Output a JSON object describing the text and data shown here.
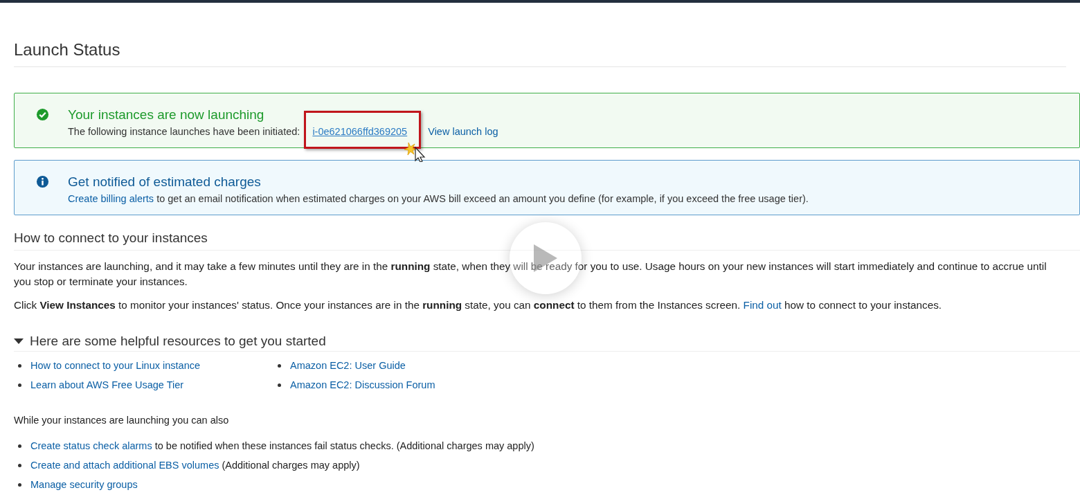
{
  "page_title": "Launch Status",
  "alerts": [
    {
      "kind": "success",
      "title": "Your instances are now launching",
      "message": [
        {
          "kind": "text",
          "text": "The following instance launches have been initiated:"
        },
        {
          "kind": "link",
          "text": "i-0e621066ffd369205",
          "highlighted": true
        },
        {
          "kind": "link",
          "text": "View launch log",
          "highlighted": false
        }
      ]
    },
    {
      "kind": "info",
      "title": "Get notified of estimated charges",
      "message": [
        {
          "kind": "link",
          "text": "Create billing alerts",
          "highlighted": false
        },
        {
          "kind": "text",
          "text": "to get an email notification when estimated charges on your AWS bill exceed an amount you define (for example, if you exceed the free usage tier)."
        }
      ]
    }
  ],
  "connect_section": {
    "heading": "How to connect to your instances",
    "paragraphs": [
      [
        {
          "kind": "text",
          "text": "Your instances are launching, and it may take a few minutes until they are in the **running** state, when they will be ready for you to use. Usage hours on your new instances will start immediately and continue to accrue until you stop or terminate your instances."
        }
      ],
      [
        {
          "kind": "text",
          "text": "Click **View Instances** to monitor your instances' status. Once your instances are in the **running** state, you can **connect** to them from the Instances screen."
        },
        {
          "kind": "link",
          "text": "Find out"
        },
        {
          "kind": "text",
          "text": "how to connect to your instances."
        }
      ]
    ]
  },
  "resources": {
    "heading": "Here are some helpful resources to get you started",
    "expanded": true,
    "columns": [
      [
        "How to connect to your Linux instance",
        "Learn about AWS Free Usage Tier"
      ],
      [
        "Amazon EC2: User Guide",
        "Amazon EC2: Discussion Forum"
      ]
    ]
  },
  "also": {
    "intro": "While your instances are launching you can also",
    "items": [
      [
        {
          "kind": "link",
          "text": "Create status check alarms"
        },
        {
          "kind": "text",
          "text": "to be notified when these instances fail status checks. (Additional charges may apply)"
        }
      ],
      [
        {
          "kind": "link",
          "text": "Create and attach additional EBS volumes"
        },
        {
          "kind": "text",
          "text": "(Additional charges may apply)"
        }
      ],
      [
        {
          "kind": "link",
          "text": "Manage security groups"
        }
      ]
    ]
  }
}
